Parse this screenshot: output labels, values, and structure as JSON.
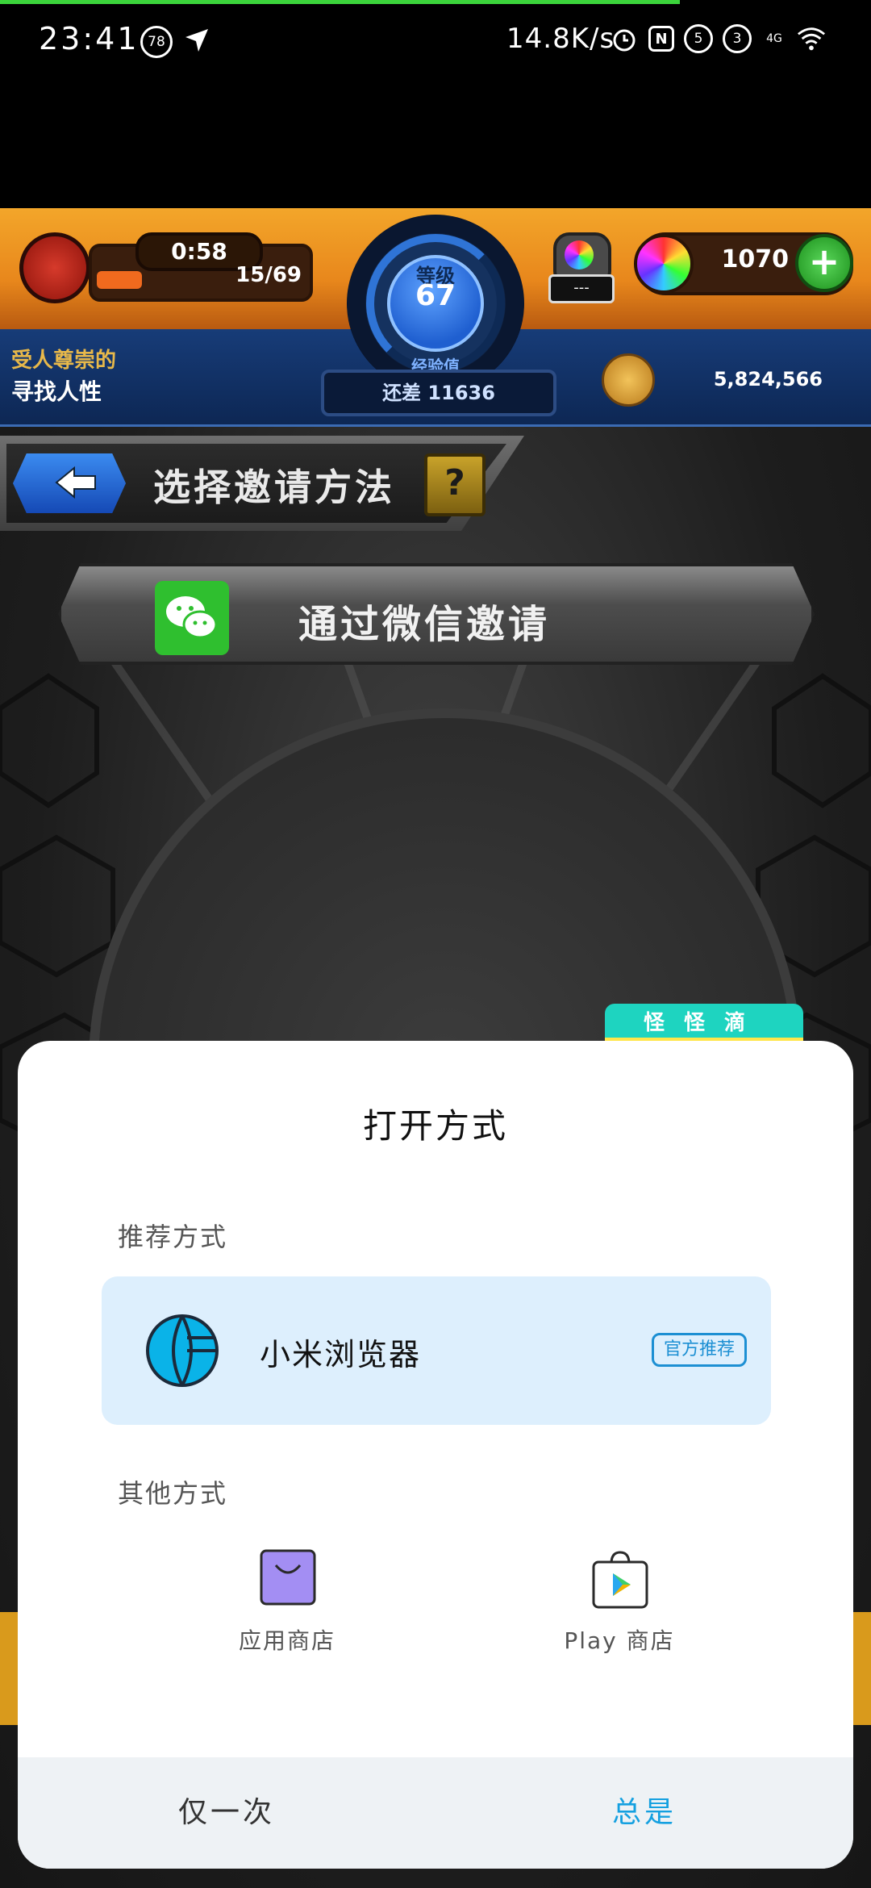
{
  "status_bar": {
    "time": "23:41",
    "notification_badge": "78",
    "network_speed": "14.8K/s",
    "icons": [
      "alarm-icon",
      "n-app-icon",
      "sim5-icon",
      "sim3-icon",
      "4g-icon",
      "wifi-icon"
    ],
    "sim1": "5",
    "sim2": "3",
    "net_type": "4G"
  },
  "game_hud": {
    "timer": "0:58",
    "energy": "15/69",
    "level_label": "等级",
    "level": "67",
    "xp_label": "经验值",
    "xp_remaining": "还差 11636",
    "ring_display": "---",
    "gems": "1070",
    "title_line1": "受人尊崇的",
    "title_line2": "寻找人性",
    "coins": "5,824,566"
  },
  "invite": {
    "header_title": "选择邀请方法",
    "help_label": "?",
    "wechat_button_label": "通过微信邀请"
  },
  "ad_tag": "怪怪滴",
  "sheet": {
    "title": "打开方式",
    "recommended_label": "推荐方式",
    "recommended_app": {
      "name": "小米浏览器",
      "badge": "官方推荐",
      "icon": "mi-browser-icon"
    },
    "other_label": "其他方式",
    "other_apps": [
      {
        "name": "应用商店",
        "icon": "app-store-icon",
        "color": "#a38ef3"
      },
      {
        "name": "Play 商店",
        "icon": "play-store-icon",
        "color": "#ffffff"
      }
    ],
    "buttons": {
      "once": "仅一次",
      "always": "总是"
    }
  },
  "colors": {
    "accent": "#14a0e0",
    "card_bg": "#ddeffd",
    "bottom_bar_bg": "#eef2f5",
    "hud_orange": "#e8871c",
    "hud_blue": "#173c78"
  }
}
